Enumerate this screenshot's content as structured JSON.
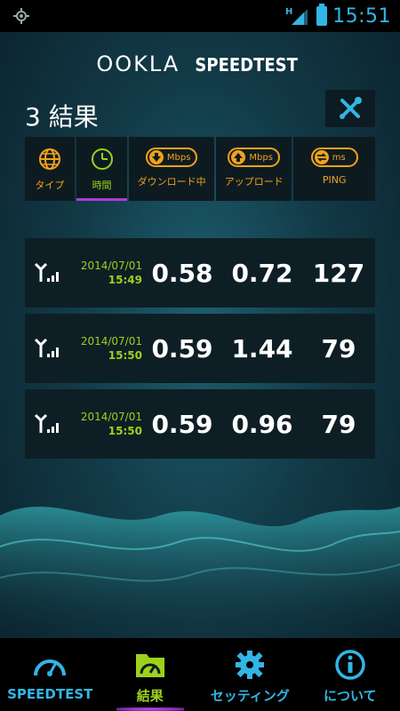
{
  "status_bar": {
    "time": "15:51",
    "network": "H"
  },
  "app": {
    "logo_left": "OOKLA",
    "logo_right": "SPEEDTEST"
  },
  "results": {
    "title": "3 結果"
  },
  "columns": {
    "type": "タイプ",
    "time": "時間",
    "download": "ダウンロード中",
    "download_unit": "Mbps",
    "upload": "アップロード",
    "upload_unit": "Mbps",
    "ping": "PING",
    "ping_unit": "ms"
  },
  "rows": [
    {
      "date": "2014/07/01",
      "time": "15:49",
      "download": "0.58",
      "upload": "0.72",
      "ping": "127"
    },
    {
      "date": "2014/07/01",
      "time": "15:50",
      "download": "0.59",
      "upload": "1.44",
      "ping": "79"
    },
    {
      "date": "2014/07/01",
      "time": "15:50",
      "download": "0.59",
      "upload": "0.96",
      "ping": "79"
    }
  ],
  "nav": {
    "speedtest": "SPEEDTEST",
    "results": "結果",
    "settings": "セッティング",
    "about": "について"
  },
  "colors": {
    "accent_blue": "#33b5e5",
    "accent_green": "#9cd21c",
    "accent_orange": "#f2a21a",
    "accent_purple": "#b03bd8"
  }
}
